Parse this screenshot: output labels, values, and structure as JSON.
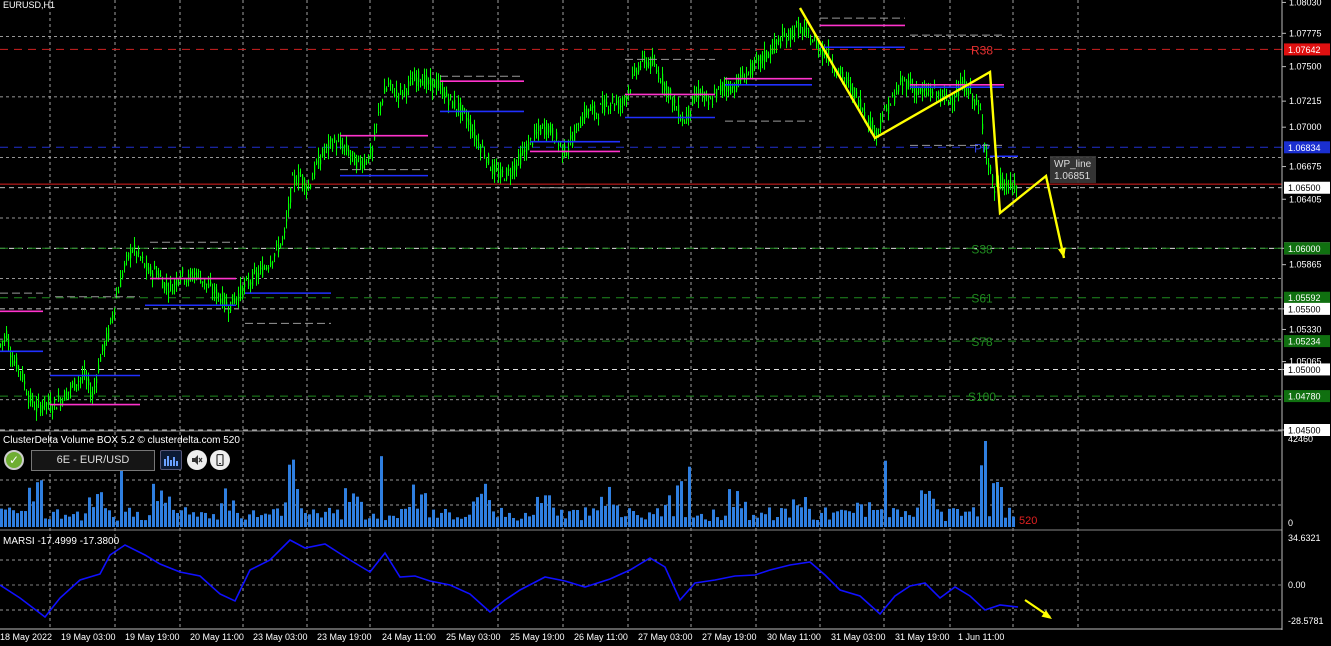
{
  "window": {
    "symbol_label": "EURUSD,H1",
    "volume_panel_title": "ClusterDelta Volume BOX 5.2 © clusterdelta.com 520",
    "volume_instrument": "6E - EUR/USD",
    "volume_last_value": "520",
    "marsi_title": "MARSI -17.4999 -17.3800",
    "wp_line_name": "WP_line",
    "wp_line_value": "1.06851"
  },
  "colors": {
    "background": "#000000",
    "grid": "#c8c8c8",
    "candle": "#00ff00",
    "volume_bars": "#2f7fe0",
    "marsi_line": "#1010ff",
    "level_line_red": "#d02020",
    "arrow_yellow": "#ffff00",
    "support_text": "#1f7a1f",
    "resistance_text": "#d02020",
    "badge_red": "#e01010",
    "badge_green": "#107010"
  },
  "chart_data": [
    {
      "type": "candlestick",
      "symbol": "EURUSD",
      "timeframe": "H1",
      "ylim": [
        1.045,
        1.0805
      ],
      "x_tick_labels": [
        "18 May 2022",
        "19 May 03:00",
        "19 May 19:00",
        "20 May 11:00",
        "23 May 03:00",
        "23 May 19:00",
        "24 May 11:00",
        "25 May 03:00",
        "25 May 19:00",
        "26 May 11:00",
        "27 May 03:00",
        "27 May 19:00",
        "30 May 11:00",
        "31 May 03:00",
        "31 May 19:00",
        "1 Jun 11:00"
      ],
      "price_axis_labels": [
        "1.08030",
        "1.07775",
        "1.07500",
        "1.07215",
        "1.07000",
        "1.06675",
        "1.06405",
        "1.06000",
        "1.05865",
        "1.05500",
        "1.05330",
        "1.05065",
        "1.05000",
        "1.04500"
      ],
      "marked_levels": [
        {
          "value": "1.07642",
          "name": "R38",
          "style": "red"
        },
        {
          "value": "1.06834",
          "name": "PP",
          "style": "blue"
        },
        {
          "value": "1.06500",
          "name": "",
          "style": "white"
        },
        {
          "value": "1.06000",
          "name": "",
          "style": "white"
        },
        {
          "value": "1.06000",
          "name": "S38",
          "style": "green"
        },
        {
          "value": "1.05592",
          "name": "S61",
          "style": "green"
        },
        {
          "value": "1.05500",
          "name": "",
          "style": "white"
        },
        {
          "value": "1.05234",
          "name": "S78",
          "style": "green"
        },
        {
          "value": "1.05000",
          "name": "",
          "style": "white"
        },
        {
          "value": "1.04780",
          "name": "S100",
          "style": "green"
        },
        {
          "value": "1.04500",
          "name": "",
          "style": "white"
        }
      ],
      "candles_ohlc_close_path": [
        [
          0,
          1.052
        ],
        [
          6,
          1.053
        ],
        [
          12,
          1.0508
        ],
        [
          20,
          1.05
        ],
        [
          28,
          1.0478
        ],
        [
          36,
          1.0468
        ],
        [
          44,
          1.0472
        ],
        [
          52,
          1.047
        ],
        [
          60,
          1.0475
        ],
        [
          68,
          1.0482
        ],
        [
          76,
          1.049
        ],
        [
          84,
          1.0495
        ],
        [
          92,
          1.0478
        ],
        [
          100,
          1.051
        ],
        [
          108,
          1.053
        ],
        [
          116,
          1.056
        ],
        [
          124,
          1.0585
        ],
        [
          132,
          1.06
        ],
        [
          140,
          1.0592
        ],
        [
          148,
          1.058
        ],
        [
          156,
          1.0582
        ],
        [
          164,
          1.057
        ],
        [
          172,
          1.0568
        ],
        [
          180,
          1.058
        ],
        [
          188,
          1.0575
        ],
        [
          196,
          1.058
        ],
        [
          204,
          1.0572
        ],
        [
          212,
          1.0565
        ],
        [
          220,
          1.056
        ],
        [
          228,
          1.0552
        ],
        [
          236,
          1.056
        ],
        [
          244,
          1.0568
        ],
        [
          252,
          1.0575
        ],
        [
          260,
          1.058
        ],
        [
          268,
          1.0588
        ],
        [
          276,
          1.0598
        ],
        [
          284,
          1.061
        ],
        [
          292,
          1.0655
        ],
        [
          300,
          1.066
        ],
        [
          308,
          1.065
        ],
        [
          316,
          1.0668
        ],
        [
          324,
          1.068
        ],
        [
          332,
          1.0688
        ],
        [
          340,
          1.0685
        ],
        [
          348,
          1.068
        ],
        [
          356,
          1.067
        ],
        [
          364,
          1.0672
        ],
        [
          372,
          1.068
        ],
        [
          380,
          1.072
        ],
        [
          388,
          1.0735
        ],
        [
          396,
          1.0728
        ],
        [
          404,
          1.073
        ],
        [
          412,
          1.0738
        ],
        [
          420,
          1.0742
        ],
        [
          428,
          1.0735
        ],
        [
          436,
          1.0736
        ],
        [
          444,
          1.0728
        ],
        [
          452,
          1.072
        ],
        [
          460,
          1.0715
        ],
        [
          468,
          1.0705
        ],
        [
          476,
          1.069
        ],
        [
          484,
          1.068
        ],
        [
          492,
          1.0665
        ],
        [
          500,
          1.066
        ],
        [
          508,
          1.0662
        ],
        [
          516,
          1.067
        ],
        [
          524,
          1.068
        ],
        [
          532,
          1.069
        ],
        [
          540,
          1.0698
        ],
        [
          548,
          1.07
        ],
        [
          556,
          1.069
        ],
        [
          564,
          1.068
        ],
        [
          572,
          1.069
        ],
        [
          580,
          1.0705
        ],
        [
          588,
          1.0715
        ],
        [
          596,
          1.0712
        ],
        [
          604,
          1.0718
        ],
        [
          612,
          1.0722
        ],
        [
          620,
          1.0718
        ],
        [
          628,
          1.073
        ],
        [
          636,
          1.0748
        ],
        [
          644,
          1.0755
        ],
        [
          652,
          1.0752
        ],
        [
          660,
          1.0742
        ],
        [
          668,
          1.073
        ],
        [
          676,
          1.0715
        ],
        [
          684,
          1.0705
        ],
        [
          692,
          1.072
        ],
        [
          700,
          1.073
        ],
        [
          708,
          1.0718
        ],
        [
          716,
          1.0728
        ],
        [
          724,
          1.0735
        ],
        [
          732,
          1.0732
        ],
        [
          740,
          1.074
        ],
        [
          748,
          1.0745
        ],
        [
          756,
          1.0752
        ],
        [
          764,
          1.0758
        ],
        [
          772,
          1.0765
        ],
        [
          780,
          1.0772
        ],
        [
          788,
          1.0775
        ],
        [
          796,
          1.0782
        ],
        [
          804,
          1.0778
        ],
        [
          812,
          1.0772
        ],
        [
          820,
          1.0765
        ],
        [
          828,
          1.076
        ],
        [
          836,
          1.0748
        ],
        [
          844,
          1.074
        ],
        [
          852,
          1.073
        ],
        [
          860,
          1.072
        ],
        [
          868,
          1.0705
        ],
        [
          876,
          1.0696
        ],
        [
          884,
          1.0712
        ],
        [
          892,
          1.0722
        ],
        [
          900,
          1.0735
        ],
        [
          908,
          1.0738
        ],
        [
          916,
          1.073
        ],
        [
          924,
          1.0728
        ],
        [
          932,
          1.073
        ],
        [
          940,
          1.0726
        ],
        [
          948,
          1.0722
        ],
        [
          956,
          1.0728
        ],
        [
          964,
          1.0735
        ],
        [
          972,
          1.0726
        ],
        [
          980,
          1.0712
        ],
        [
          988,
          1.067
        ],
        [
          994,
          1.0648
        ],
        [
          1000,
          1.0655
        ],
        [
          1006,
          1.0652
        ],
        [
          1012,
          1.065
        ],
        [
          1018,
          1.0652
        ]
      ]
    },
    {
      "type": "bar",
      "title": "ClusterDelta Volume BOX 5.2 © clusterdelta.com 520",
      "ylim": [
        0,
        42460
      ],
      "y_tick_labels": [
        "42460",
        "0"
      ],
      "last_value": 520
    },
    {
      "type": "line",
      "title": "MARSI -17.4999 -17.3800",
      "values_shown": [
        -17.4999,
        -17.38
      ],
      "ylim": [
        -28.5781,
        34.6321
      ],
      "y_tick_labels": [
        "34.6321",
        "0.00",
        "-28.5781"
      ]
    }
  ]
}
